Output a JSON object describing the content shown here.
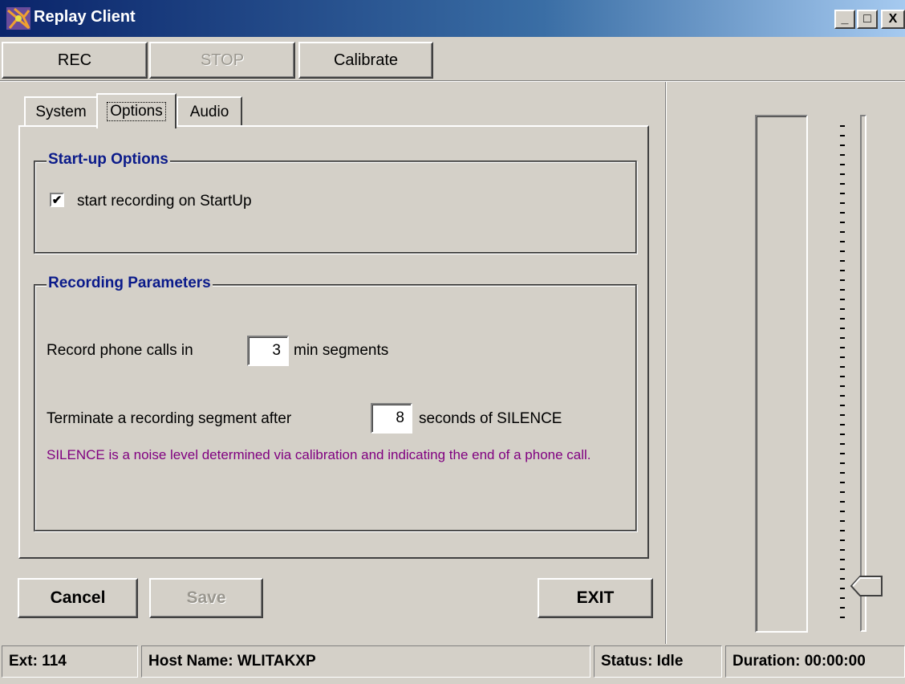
{
  "window": {
    "title": "Replay Client",
    "icon": "replay-app-icon",
    "minimize_glyph": "_",
    "maximize_glyph": "□",
    "close_glyph": "X"
  },
  "toolbar": {
    "rec_label": "REC",
    "stop_label": "STOP",
    "calibrate_label": "Calibrate"
  },
  "tabs": [
    {
      "label": "System"
    },
    {
      "label": "Options",
      "active": true
    },
    {
      "label": "Audio"
    }
  ],
  "startup_options": {
    "title": "Start-up Options",
    "start_recording_label": "start recording on StartUp",
    "start_recording_checked": true,
    "check_glyph": "✔"
  },
  "recording_parameters": {
    "title": "Recording Parameters",
    "segment_prefix": "Record phone calls  in",
    "segment_value": "3",
    "segment_suffix": "min segments",
    "silence_prefix": "Terminate a recording segment after",
    "silence_value": "8",
    "silence_suffix": "seconds of SILENCE",
    "silence_note": "SILENCE is a noise level determined via calibration and indicating the end of a phone call."
  },
  "actions": {
    "cancel_label": "Cancel",
    "save_label": "Save",
    "exit_label": "EXIT"
  },
  "level_slider": {
    "position_fraction": 0.05
  },
  "statusbar": {
    "ext": "Ext: 114",
    "host": "Host Name: WLITAKXP",
    "status": "Status: Idle",
    "duration": "Duration: 00:00:00"
  },
  "colors": {
    "titlebar_start": "#0a246a",
    "group_title": "#0a1a8a",
    "note_text": "#800080",
    "face": "#d4d0c8"
  }
}
